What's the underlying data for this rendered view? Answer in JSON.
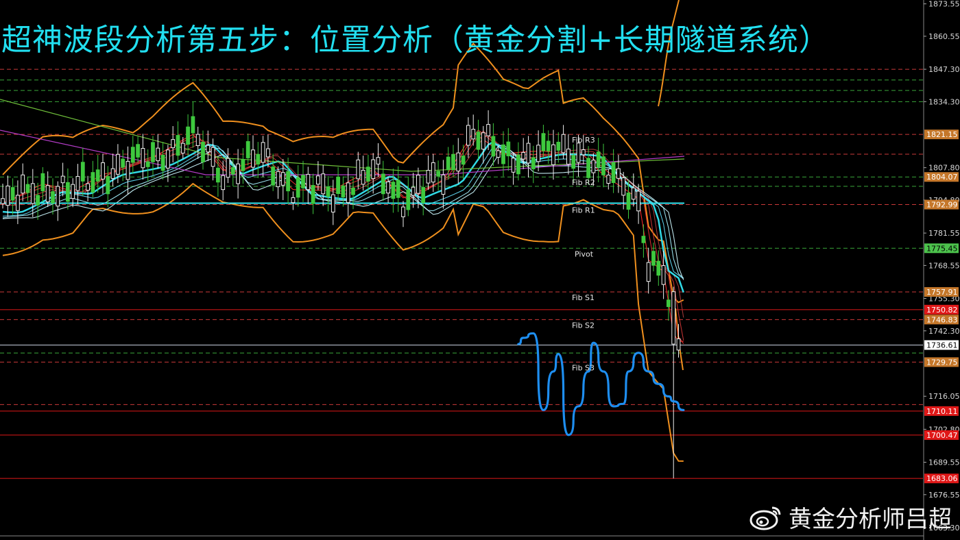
{
  "title": "超神波段分析第五步：位置分析（黄金分割+长期隧道系统）",
  "watermark": {
    "text": "黄金分析师吕超",
    "icon": "weibo-icon"
  },
  "colors": {
    "background": "#000000",
    "title": "#22dff0",
    "forecast": "#1e8ef0",
    "band": "#f0901e",
    "tunnel": "#33e6f2",
    "candle_up": "#f2f2f2",
    "candle_down": "#3ec93e",
    "red_level": "#e01818",
    "dashed_red": "#cc3a3a",
    "dashed_green": "#3aa83a"
  },
  "chart_data": {
    "type": "line",
    "instrument_hint": "gold candlestick chart with Bollinger bands, EMA tunnel, pivot levels and hand-drawn forecast",
    "y_axis": {
      "range": [
        1660.0,
        1874.0
      ],
      "ticks": [
        "1873.55",
        "1860.55",
        "1847.30",
        "1834.30",
        "1807.80",
        "1794.80",
        "1781.55",
        "1768.55",
        "1755.30",
        "1742.30",
        "1716.05",
        "1702.80",
        "1689.55",
        "1676.55",
        "1663.30"
      ]
    },
    "price_labels": [
      {
        "value": 1821.15,
        "text": "1821.15",
        "style": "brown"
      },
      {
        "value": 1804.07,
        "text": "1804.07",
        "style": "brown"
      },
      {
        "value": 1792.99,
        "text": "1792.99",
        "style": "brown"
      },
      {
        "value": 1775.45,
        "text": "1775.45",
        "style": "green"
      },
      {
        "value": 1757.91,
        "text": "1757.91",
        "style": "brown"
      },
      {
        "value": 1750.82,
        "text": "1750.82",
        "style": "red"
      },
      {
        "value": 1746.83,
        "text": "1746.83",
        "style": "brown"
      },
      {
        "value": 1736.61,
        "text": "1736.61",
        "style": "white"
      },
      {
        "value": 1729.75,
        "text": "1729.75",
        "style": "brown"
      },
      {
        "value": 1710.11,
        "text": "1710.11",
        "style": "red"
      },
      {
        "value": 1700.47,
        "text": "1700.47",
        "style": "red"
      },
      {
        "value": 1683.06,
        "text": "1683.06",
        "style": "red"
      }
    ],
    "pivot_levels": [
      {
        "name": "Fib R3",
        "value": 1821.15
      },
      {
        "name": "Fib R2",
        "value": 1804.07
      },
      {
        "name": "Fib R1",
        "value": 1792.99
      },
      {
        "name": "Pivot",
        "value": 1775.45
      },
      {
        "name": "Fib S1",
        "value": 1757.91
      },
      {
        "name": "Fib S2",
        "value": 1746.83
      },
      {
        "name": "Fib S3",
        "value": 1729.75
      }
    ],
    "extra_dashed_levels": [
      {
        "value": 1847.3,
        "color": "red"
      },
      {
        "value": 1843.0,
        "color": "green"
      },
      {
        "value": 1838.8,
        "color": "green"
      },
      {
        "value": 1834.3,
        "color": "green"
      },
      {
        "value": 1813.2,
        "color": "red"
      },
      {
        "value": 1800.3,
        "color": "green"
      },
      {
        "value": 1733.4,
        "color": "green"
      },
      {
        "value": 1712.7,
        "color": "red"
      }
    ],
    "solid_levels": [
      {
        "value": 1750.82,
        "color": "red"
      },
      {
        "value": 1736.61,
        "color": "white"
      },
      {
        "value": 1710.11,
        "color": "red"
      },
      {
        "value": 1700.47,
        "color": "red"
      },
      {
        "value": 1683.06,
        "color": "red"
      }
    ],
    "forecast_path": {
      "name": "",
      "bars": [
        103,
        104,
        106,
        108,
        110,
        111,
        113,
        115,
        117,
        118,
        120,
        122,
        124,
        125,
        127,
        129,
        131,
        133,
        134,
        136
      ],
      "values": [
        1737.0,
        1739.5,
        1741.3,
        1710.5,
        1726.0,
        1733.0,
        1700.5,
        1712.0,
        1726.0,
        1737.5,
        1726.0,
        1712.0,
        1713.0,
        1726.0,
        1733.5,
        1726.0,
        1721.0,
        1716.0,
        1714.0,
        1710.5
      ]
    },
    "x_range_bars": [
      0,
      137
    ],
    "grid": false
  }
}
